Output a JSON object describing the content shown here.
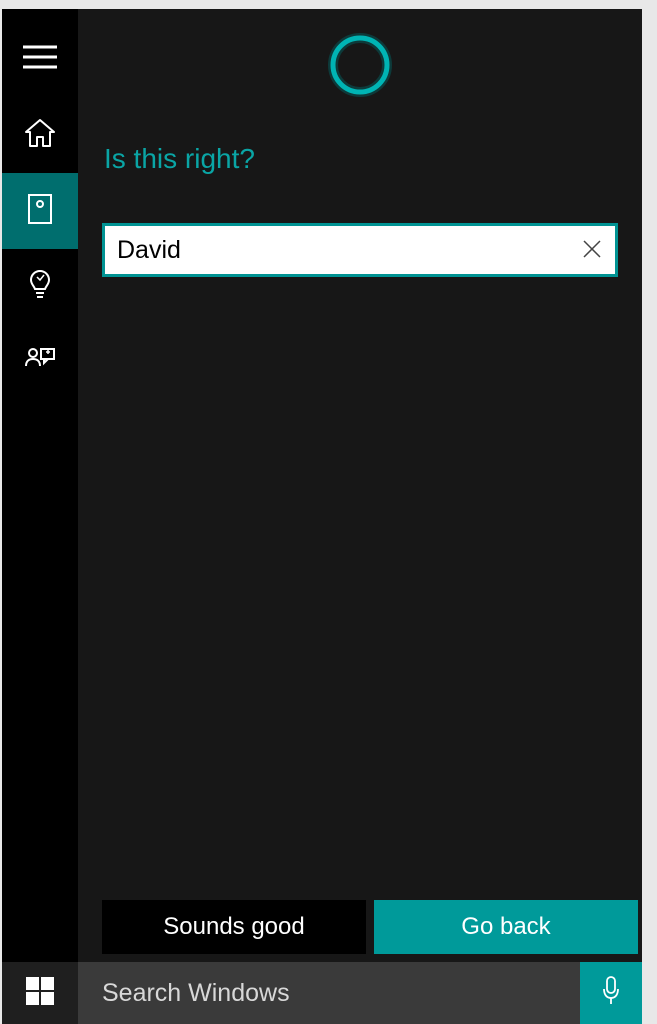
{
  "sidebar": {
    "items": [
      {
        "name": "menu",
        "active": false
      },
      {
        "name": "home",
        "active": false
      },
      {
        "name": "notebook",
        "active": true
      },
      {
        "name": "tips",
        "active": false
      },
      {
        "name": "feedback",
        "active": false
      }
    ]
  },
  "cortana": {
    "prompt_title": "Is this right?",
    "input_value": "David",
    "buttons": {
      "confirm": "Sounds good",
      "back": "Go back"
    }
  },
  "taskbar": {
    "search_placeholder": "Search Windows"
  }
}
